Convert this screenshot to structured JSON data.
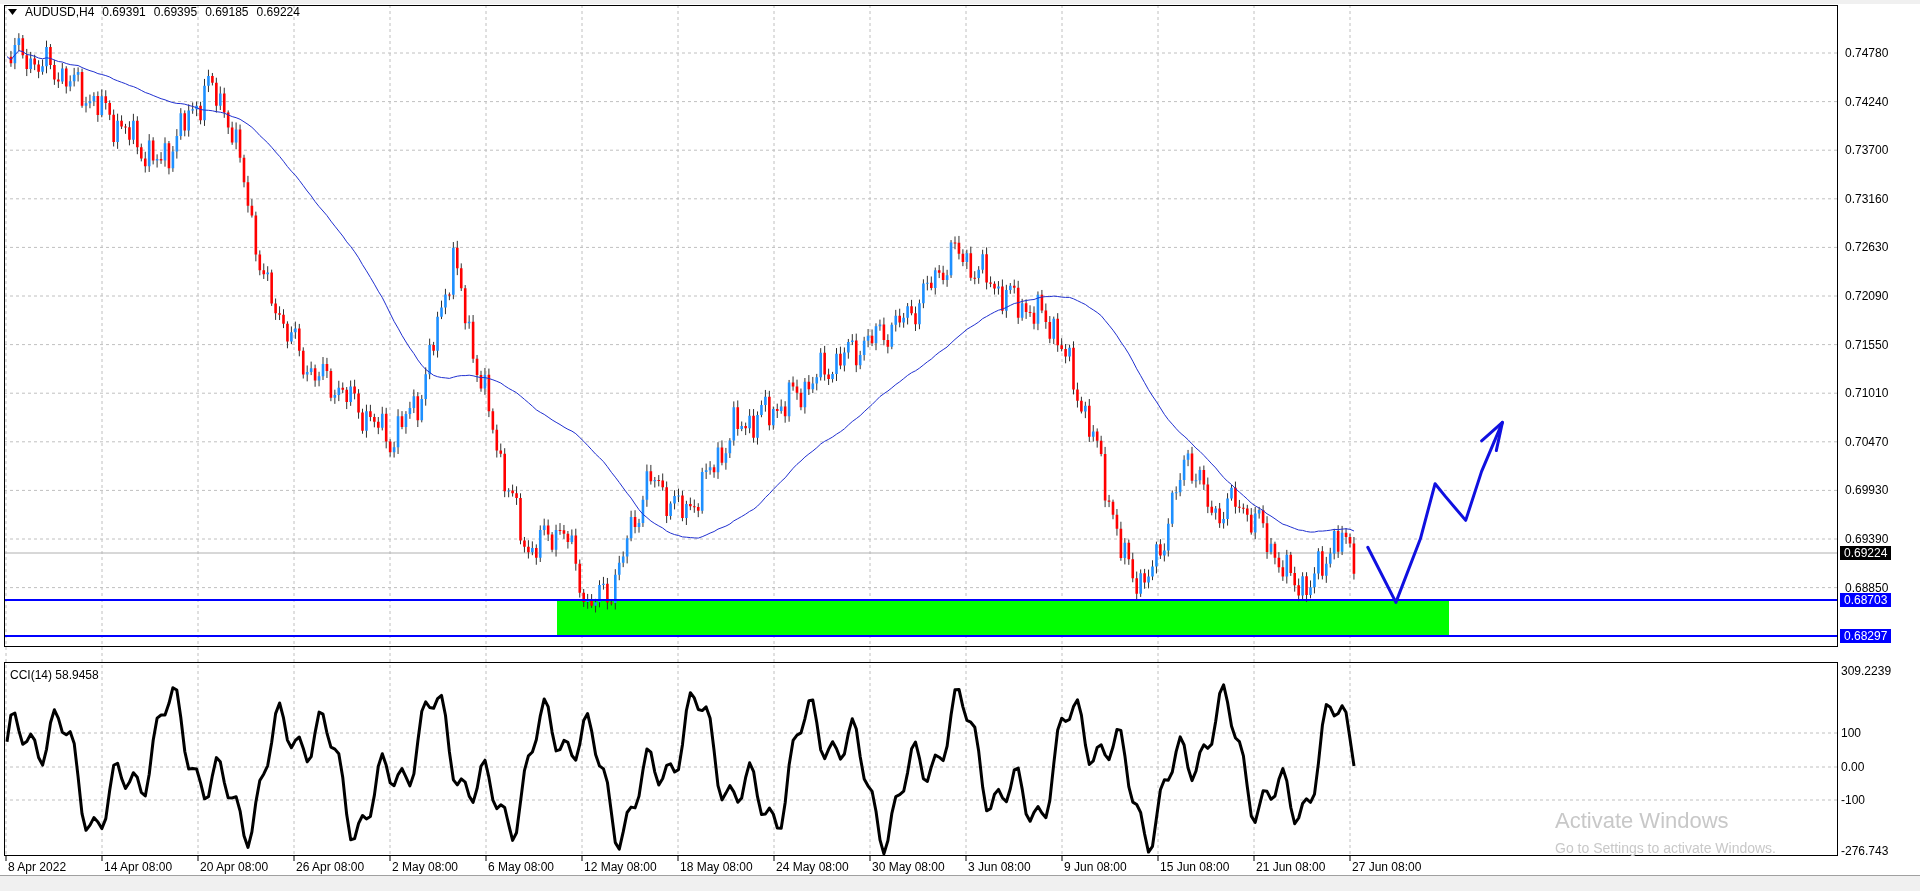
{
  "chart_header": {
    "symbol": "AUDUSD,H4",
    "quotes": [
      "0.69391",
      "0.69395",
      "0.69185",
      "0.69224"
    ]
  },
  "price_axis": [
    "0.74780",
    "0.74240",
    "0.73700",
    "0.73160",
    "0.72630",
    "0.72090",
    "0.71550",
    "0.71010",
    "0.70470",
    "0.69930",
    "0.69390",
    "0.68850"
  ],
  "price_tags": [
    {
      "label": "0.69224",
      "kind": "bid"
    },
    {
      "label": "0.68703",
      "kind": "line"
    },
    {
      "label": "0.68297",
      "kind": "line"
    }
  ],
  "indicator": {
    "label": "CCI(14) 58.9458",
    "axis": [
      "309.2239",
      "100",
      "0.00",
      "-100",
      "-276.743"
    ]
  },
  "time_axis": [
    "8 Apr 2022",
    "14 Apr 08:00",
    "20 Apr 08:00",
    "26 Apr 08:00",
    "2 May 08:00",
    "6 May 08:00",
    "12 May 08:00",
    "18 May 08:00",
    "24 May 08:00",
    "30 May 08:00",
    "3 Jun 08:00",
    "9 Jun 08:00",
    "15 Jun 08:00",
    "21 Jun 08:00",
    "27 Jun 08:00"
  ],
  "os_notice": {
    "title": "Activate Windows",
    "text": "Go to Settings to activate Windows."
  }
}
